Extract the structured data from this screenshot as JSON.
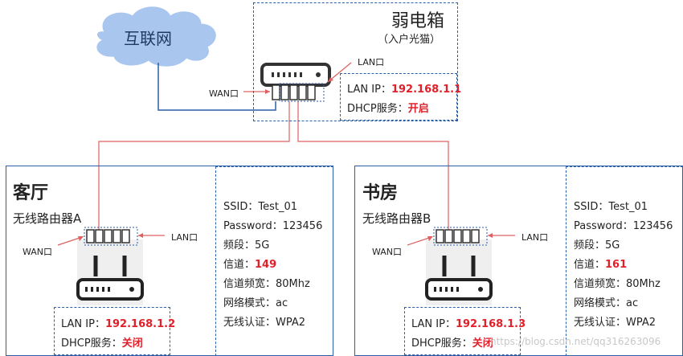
{
  "cloud": {
    "label": "互联网"
  },
  "closet": {
    "title": "弱电箱",
    "subtitle": "（入户光猫）",
    "wan_label": "WAN口",
    "lan_label": "LAN口",
    "lan_ip_label": "LAN IP：",
    "lan_ip": "192.168.1.1",
    "dhcp_label": "DHCP服务：",
    "dhcp": "开启"
  },
  "rooms": [
    {
      "title": "客厅",
      "router": "无线路由器A",
      "wan_label": "WAN口",
      "lan_label": "LAN口",
      "lan_ip_label": "LAN IP：",
      "lan_ip": "192.168.1.2",
      "dhcp_label": "DHCP服务：",
      "dhcp": "关闭",
      "wifi": {
        "ssid": "SSID：Test_01",
        "password": "Password：123456",
        "band": "频段：5G",
        "channel_label": "信道：",
        "channel": "149",
        "width": "信道频宽：80Mhz",
        "mode": "网络模式：ac",
        "auth": "无线认证：WPA2"
      }
    },
    {
      "title": "书房",
      "router": "无线路由器B",
      "wan_label": "WAN口",
      "lan_label": "LAN口",
      "lan_ip_label": "LAN IP：",
      "lan_ip": "192.168.1.3",
      "dhcp_label": "DHCP服务：",
      "dhcp": "关闭",
      "wifi": {
        "ssid": "SSID：Test_01",
        "password": "Password：123456",
        "band": "频段：5G",
        "channel_label": "信道：",
        "channel": "161",
        "width": "信道频宽：80Mhz",
        "mode": "网络模式：ac",
        "auth": "无线认证：WPA2"
      }
    }
  ],
  "watermark": "https://blog.csdn.net/qq316263096",
  "colors": {
    "border": "#2b5fa8",
    "cable_red": "#e06060",
    "cable_blue": "#2b5fa8",
    "highlight": "#e0202a",
    "cloud": "#a9c7ee"
  }
}
